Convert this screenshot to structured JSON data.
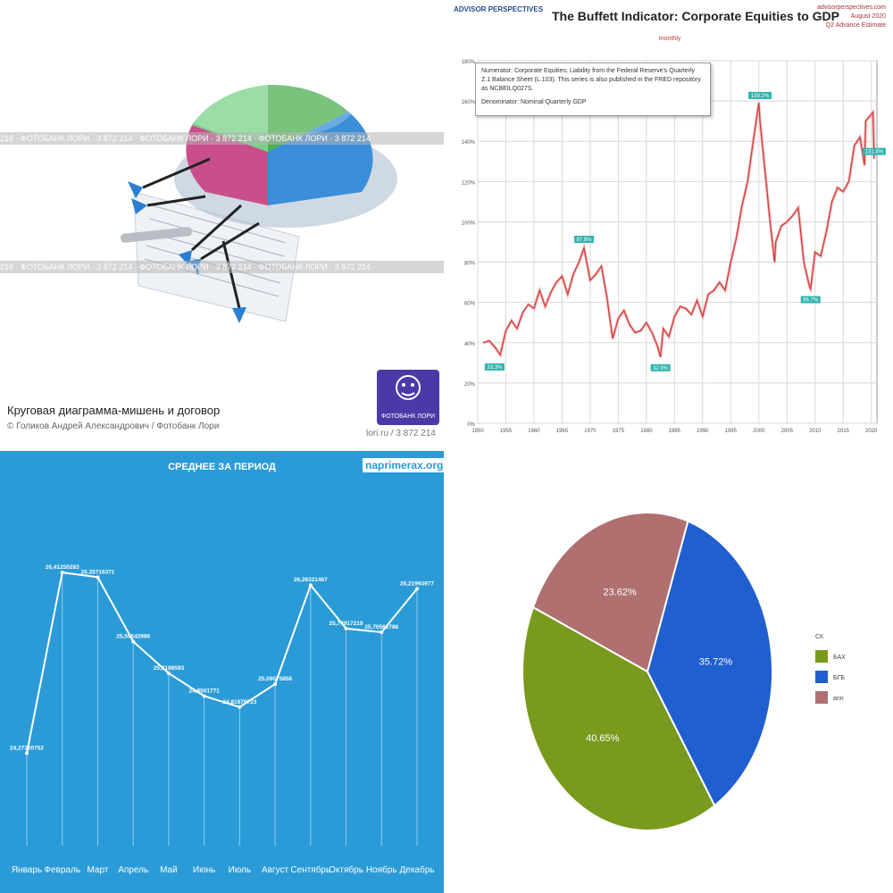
{
  "photo_panel": {
    "watermark_text": "218 · ФОТОБАНК ЛОРИ · 3 872 214 · ФОТОБАНК ЛОРИ · 3 872 214 · ФОТОБАНК ЛОРИ · 3 872 214 ·",
    "title": "Круговая диаграмма-мишень и договор",
    "credit": "© Голиков Андрей Александрович / Фотобанк Лори",
    "id": "lori.ru / 3 872 214",
    "logo_label": "ФОТОБАНК ЛОРИ"
  },
  "chart_data": [
    {
      "type": "line",
      "title": "The Buffett Indicator: Corporate Equities to GDP",
      "brand": "ADVISOR PERSPECTIVES",
      "subtitle": "monthly",
      "source_lines": [
        "advisorperspectives.com",
        "August 2020",
        "Q2 Advance Estimate"
      ],
      "note": {
        "numerator": "Numerator: Corporate Equities; Liability from the Federal Reserve's Quarterly Z.1 Balance Sheet (L.103). This series is also published in the FRED repository as NCBEILQ027S.",
        "denominator": "Denominator: Nominal Quarterly GDP"
      },
      "xlim": [
        1950,
        2021
      ],
      "ylim": [
        0,
        180
      ],
      "x_ticks": [
        "1950",
        "1955",
        "1960",
        "1965",
        "1970",
        "1975",
        "1980",
        "1985",
        "1990",
        "1995",
        "2000",
        "2005",
        "2010",
        "2015",
        "2020"
      ],
      "y_ticks": [
        "0%",
        "20%",
        "40%",
        "60%",
        "80%",
        "100%",
        "120%",
        "140%",
        "160%",
        "180%"
      ],
      "grid": true,
      "line_color": "#d23a3a",
      "x": [
        1951,
        1952,
        1953,
        1954,
        1955,
        1956,
        1957,
        1958,
        1959,
        1960,
        1961,
        1962,
        1963,
        1964,
        1965,
        1966,
        1967,
        1968,
        1968.9,
        1970,
        1971,
        1972,
        1973,
        1974,
        1975,
        1976,
        1977,
        1978,
        1979,
        1980,
        1981,
        1982,
        1982.5,
        1983,
        1984,
        1985,
        1986,
        1987,
        1988,
        1989,
        1990,
        1991,
        1992,
        1993,
        1994,
        1995,
        1996,
        1997,
        1998,
        1999,
        2000,
        2000.2,
        2001,
        2002,
        2002.8,
        2003,
        2004,
        2005,
        2006,
        2007,
        2008,
        2009,
        2009.2,
        2010,
        2011,
        2012,
        2013,
        2014,
        2015,
        2016,
        2017,
        2018,
        2018.8,
        2019,
        2020.3,
        2020.5
      ],
      "y": [
        40,
        41,
        38,
        34,
        46,
        51,
        47,
        55,
        59,
        57,
        66,
        58,
        65,
        70,
        73,
        64,
        74,
        80,
        87,
        71,
        74,
        78,
        62,
        42,
        52,
        56,
        49,
        45,
        46,
        50,
        45,
        38,
        32.9,
        47,
        43,
        53,
        58,
        57,
        54,
        61,
        53,
        64,
        66,
        70,
        66,
        80,
        92,
        108,
        120,
        140,
        159.2,
        150,
        128,
        100,
        80,
        90,
        98,
        100,
        103,
        107,
        80,
        68,
        66.7,
        85,
        83,
        95,
        110,
        117,
        115,
        120,
        138,
        142,
        128,
        150,
        154.4,
        131.4
      ],
      "annotations": [
        {
          "x": 1953,
          "y": 33.3,
          "label": "33.3%"
        },
        {
          "x": 1968.9,
          "y": 87.8,
          "label": "87.8%"
        },
        {
          "x": 1982.5,
          "y": 32.9,
          "label": "32.9%"
        },
        {
          "x": 2000.2,
          "y": 159.2,
          "label": "159.2%"
        },
        {
          "x": 2009.2,
          "y": 66.7,
          "label": "66.7%"
        },
        {
          "x": 2020.5,
          "y": 131.4,
          "label": "131.4%"
        }
      ]
    },
    {
      "type": "line",
      "title": "СРЕДНЕЕ ЗА ПЕРИОД",
      "site": "naprimerax.org",
      "categories": [
        "Январь",
        "Февраль",
        "Март",
        "Апрель",
        "Май",
        "Июнь",
        "Июль",
        "Август",
        "Сентябрь",
        "Октябрь",
        "Ноябрь",
        "Декабрь"
      ],
      "values": [
        24.2732075,
        26.41250283,
        26.35716371,
        25.59542986,
        25.2198593,
        24.9501771,
        24.81979723,
        25.09075858,
        26.26321467,
        25.74917219,
        25.70562786,
        26.21993977
      ],
      "value_labels": [
        "24,27320752",
        "26,41250283",
        "26,35716371",
        "25,59542986",
        "25,2198593",
        "24,9501771",
        "24,81979723",
        "25,09075858",
        "26,26321467",
        "25,74917219",
        "25,70562786",
        "26,21993977"
      ],
      "ylim": [
        23.2,
        26.9
      ],
      "line_color": "#ffffff",
      "background": "#2a9bd6"
    },
    {
      "type": "pie",
      "legend_title": "СК",
      "legend_position": "right",
      "slices": [
        {
          "label": "БАХ",
          "value": 40.65,
          "display": "40.65%",
          "color": "#7a9a1e"
        },
        {
          "label": "БГБ",
          "value": 35.72,
          "display": "35.72%",
          "color": "#1f5fcf"
        },
        {
          "label": "ann",
          "value": 23.62,
          "display": "23.62%",
          "color": "#b07070"
        }
      ]
    }
  ]
}
